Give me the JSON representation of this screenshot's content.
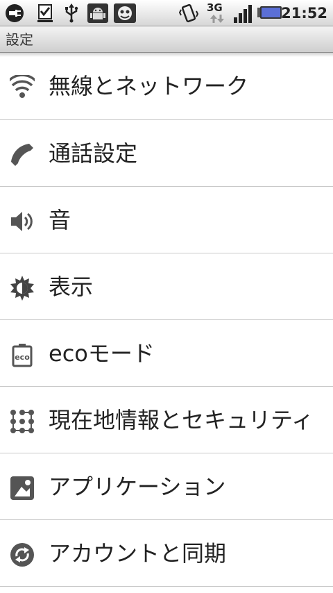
{
  "status_bar": {
    "network_type": "3G",
    "time": "21:52"
  },
  "title_bar": {
    "title": "設定"
  },
  "settings_items": [
    {
      "label": "無線とネットワーク",
      "icon": "wifi-icon"
    },
    {
      "label": "通話設定",
      "icon": "phone-icon"
    },
    {
      "label": "音",
      "icon": "speaker-icon"
    },
    {
      "label": "表示",
      "icon": "brightness-icon"
    },
    {
      "label": "ecoモード",
      "icon": "eco-battery-icon"
    },
    {
      "label": "現在地情報とセキュリティ",
      "icon": "security-grid-icon"
    },
    {
      "label": "アプリケーション",
      "icon": "android-app-icon"
    },
    {
      "label": "アカウントと同期",
      "icon": "sync-icon"
    }
  ]
}
